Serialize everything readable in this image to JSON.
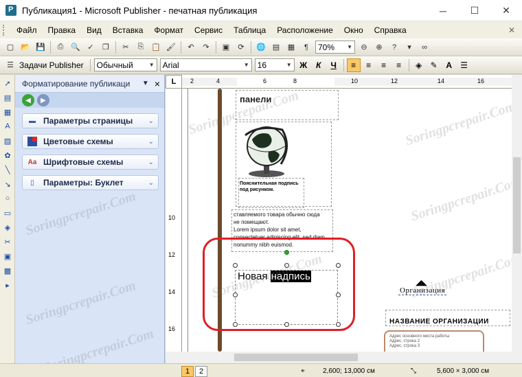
{
  "window": {
    "title": "Публикация1 - Microsoft Publisher - печатная публикация"
  },
  "menu": {
    "items": [
      "Файл",
      "Правка",
      "Вид",
      "Вставка",
      "Формат",
      "Сервис",
      "Таблица",
      "Расположение",
      "Окно",
      "Справка"
    ],
    "end_symbol": "✕"
  },
  "toolbar": {
    "zoom": "70%"
  },
  "format_toolbar": {
    "tasks_label": "Задачи Publisher",
    "style": "Обычный",
    "font": "Arial",
    "size": "16",
    "bold": "Ж",
    "italic": "К",
    "underline": "Ч"
  },
  "task_pane": {
    "title": "Форматирование публикаци",
    "items": [
      {
        "label": "Параметры страницы"
      },
      {
        "label": "Цветовые схемы"
      },
      {
        "label": "Шрифтовые схемы"
      },
      {
        "label": "Параметры: Буклет"
      }
    ]
  },
  "rulers": {
    "corner": "L",
    "h_ticks": [
      "2",
      "4",
      "6",
      "8",
      "10",
      "12",
      "14",
      "16"
    ],
    "v_ticks": [
      "10",
      "12",
      "14",
      "16"
    ]
  },
  "canvas": {
    "panel_title": "панели",
    "caption": "Пояснительная подпись под рисунком.",
    "body_line1": "ставляемого товара обычно сюда",
    "body_line2": "не помещают.",
    "body_line3": "Lorem ipsum dolor sit amet,",
    "body_line4": "consectetuer adipiscing elit, sed diam",
    "body_line5": "nonummy nibh euismod.",
    "new_text_plain": "Новая",
    "new_text_selected": "надпись",
    "org_small": "Организация",
    "org_heading": "НАЗВАНИЕ ОРГАНИЗАЦИИ",
    "org_addr1": "Адрес основного места работы",
    "org_addr2": "Адрес, строка 2",
    "org_addr3": "Адрес, строка 3"
  },
  "status": {
    "page1": "1",
    "page2": "2",
    "position": "2,600; 13,000 см",
    "size": "5,600 × 3,000 см"
  },
  "watermark": "Soringpcrepair.Com"
}
